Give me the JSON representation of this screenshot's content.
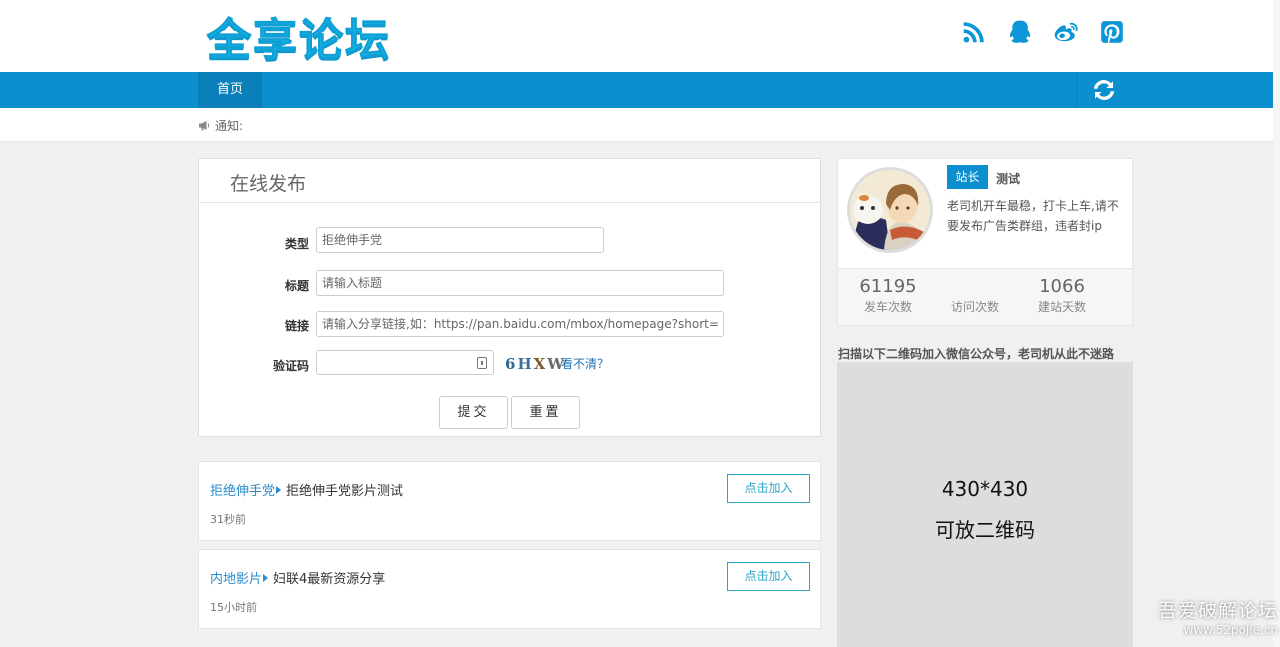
{
  "header": {
    "logo_text": "全享论坛",
    "social_icons": [
      "rss-icon",
      "qq-icon",
      "weibo-icon",
      "pinterest-icon"
    ]
  },
  "nav": {
    "home_label": "首页",
    "refresh_icon": "refresh-icon"
  },
  "notice": {
    "label": "通知:"
  },
  "form": {
    "title": "在线发布",
    "type_label": "类型",
    "type_value": "拒绝伸手党",
    "title_label": "标题",
    "title_placeholder": "请输入标题",
    "link_label": "链接",
    "link_placeholder": "请输入分享链接,如：https://pan.baidu.com/mbox/homepage?short=xxx",
    "captcha_label": "验证码",
    "captcha_value": "",
    "captcha_chars": [
      "6",
      "H",
      "X",
      "W"
    ],
    "captcha_link": "看不清？",
    "submit_label": "提交",
    "reset_label": "重置"
  },
  "posts": [
    {
      "category": "拒绝伸手党",
      "title": "拒绝伸手党影片测试",
      "time": "31秒前",
      "join_label": "点击加入"
    },
    {
      "category": "内地影片",
      "title": "妇联4最新资源分享",
      "time": "15小时前",
      "join_label": "点击加入"
    }
  ],
  "profile": {
    "badge": "站长",
    "name": "测试",
    "description": "老司机开车最稳，打卡上车,请不要发布广告类群组，违者封ip",
    "stats": [
      {
        "value": "61195",
        "label": "发车次数"
      },
      {
        "value": "",
        "label": "访问次数"
      },
      {
        "value": "1066",
        "label": "建站天数"
      }
    ]
  },
  "qr": {
    "caption": "扫描以下二维码加入微信公众号，老司机从此不迷路",
    "line1": "430*430",
    "line2": "可放二维码"
  },
  "watermark": {
    "line1": "吾爱破解论坛",
    "line2": "www.52pojie.cn"
  },
  "colors": {
    "primary": "#0c8fcf",
    "logo": "#1bb4ec",
    "link": "#2b8ccc"
  }
}
